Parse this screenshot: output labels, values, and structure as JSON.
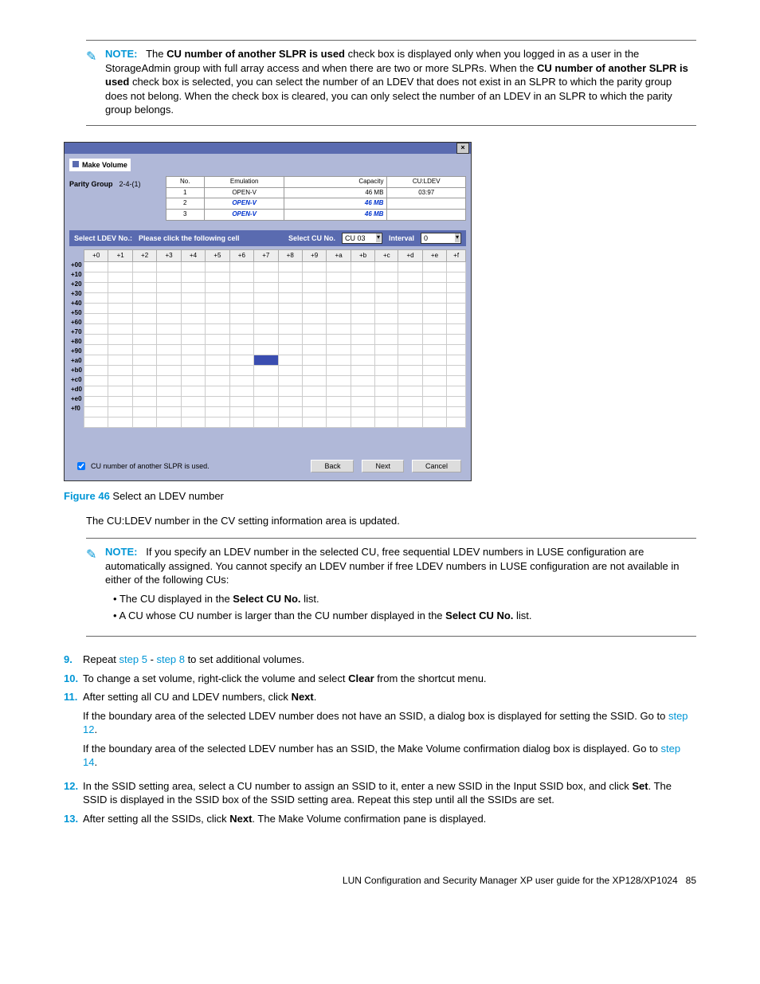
{
  "note1": {
    "label": "NOTE:",
    "body_a": "The ",
    "bold_a": "CU number of another SLPR is used",
    "body_b": " check box is displayed only when you logged in as a user in the StorageAdmin group with full array access and when there are two or more SLPRs. When the ",
    "bold_b": "CU number of another SLPR is used",
    "body_c": " check box is selected, you can select the number of an LDEV that does not exist in an SLPR to which the parity group does not belong. When the check box is cleared, you can only select the number of an LDEV in an SLPR to which the parity group belongs."
  },
  "dialog": {
    "title": "Make Volume",
    "pg_label": "Parity Group",
    "pg_value": "2-4-(1)",
    "table_headers": {
      "no": "No.",
      "emu": "Emulation",
      "cap": "Capacity",
      "cu": "CU:LDEV"
    },
    "rows": [
      {
        "no": "1",
        "emu": "OPEN-V",
        "cap": "46 MB",
        "cu": "03:97",
        "bold": false
      },
      {
        "no": "2",
        "emu": "OPEN-V",
        "cap": "46 MB",
        "cu": "",
        "bold": true
      },
      {
        "no": "3",
        "emu": "OPEN-V",
        "cap": "46 MB",
        "cu": "",
        "bold": true
      }
    ],
    "sel_ldev_label": "Select LDEV No.:",
    "sel_ldev_hint": "Please click the following cell",
    "sel_cu_label": "Select CU No.",
    "sel_cu_value": "CU 03",
    "interval_label": "Interval",
    "interval_value": "0",
    "col_headers": [
      "+0",
      "+1",
      "+2",
      "+3",
      "+4",
      "+5",
      "+6",
      "+7",
      "+8",
      "+9",
      "+a",
      "+b",
      "+c",
      "+d",
      "+e",
      "+f"
    ],
    "row_headers": [
      "+00",
      "+10",
      "+20",
      "+30",
      "+40",
      "+50",
      "+60",
      "+70",
      "+80",
      "+90",
      "+a0",
      "+b0",
      "+c0",
      "+d0",
      "+e0",
      "+f0"
    ],
    "selected": {
      "row": 9,
      "col": 7
    },
    "checkbox_label": "CU number of another SLPR is used.",
    "buttons": {
      "back": "Back",
      "next": "Next",
      "cancel": "Cancel"
    }
  },
  "figure": {
    "label": "Figure 46",
    "caption": " Select an LDEV number"
  },
  "after_figure": "The CU:LDEV number in the CV setting information area is updated.",
  "note2": {
    "label": "NOTE:",
    "body": "If you specify an LDEV number in the selected CU, free sequential LDEV numbers in LUSE configuration are automatically assigned. You cannot specify an LDEV number if free LDEV numbers in LUSE configuration are not available in either of the following CUs:",
    "b1a": "The CU displayed in the ",
    "b1b": "Select CU No.",
    "b1c": " list.",
    "b2a": "A CU whose CU number is larger than the CU number displayed in the ",
    "b2b": "Select CU No.",
    "b2c": " list."
  },
  "steps": {
    "s9": {
      "n": "9.",
      "a": "Repeat ",
      "l1": "step 5",
      "mid": " - ",
      "l2": "step 8",
      "b": " to set additional volumes."
    },
    "s10": {
      "n": "10.",
      "a": "To change a set volume, right-click the volume and select ",
      "bold": "Clear",
      "b": " from the shortcut menu."
    },
    "s11": {
      "n": "11.",
      "a": "After setting all CU and LDEV numbers, click ",
      "bold": "Next",
      "b": ".",
      "p1a": "If the boundary area of the selected LDEV number does not have an SSID, a dialog box is displayed for setting the SSID. Go to ",
      "p1l": "step 12",
      "p1b": ".",
      "p2a": "If the boundary area of the selected LDEV number has an SSID, the Make Volume confirmation dialog box is displayed. Go to ",
      "p2l": "step 14",
      "p2b": "."
    },
    "s12": {
      "n": "12.",
      "a": "In the SSID setting area, select a CU number to assign an SSID to it, enter a new SSID in the Input SSID box, and click ",
      "bold": "Set",
      "b": ". The SSID is displayed in the SSID box of the SSID setting area. Repeat this step until all the SSIDs are set."
    },
    "s13": {
      "n": "13.",
      "a": "After setting all the SSIDs, click ",
      "bold": "Next",
      "b": ". The Make Volume confirmation pane is displayed."
    }
  },
  "footer": {
    "text": "LUN Configuration and Security Manager XP user guide for the XP128/XP1024",
    "page": "85"
  }
}
